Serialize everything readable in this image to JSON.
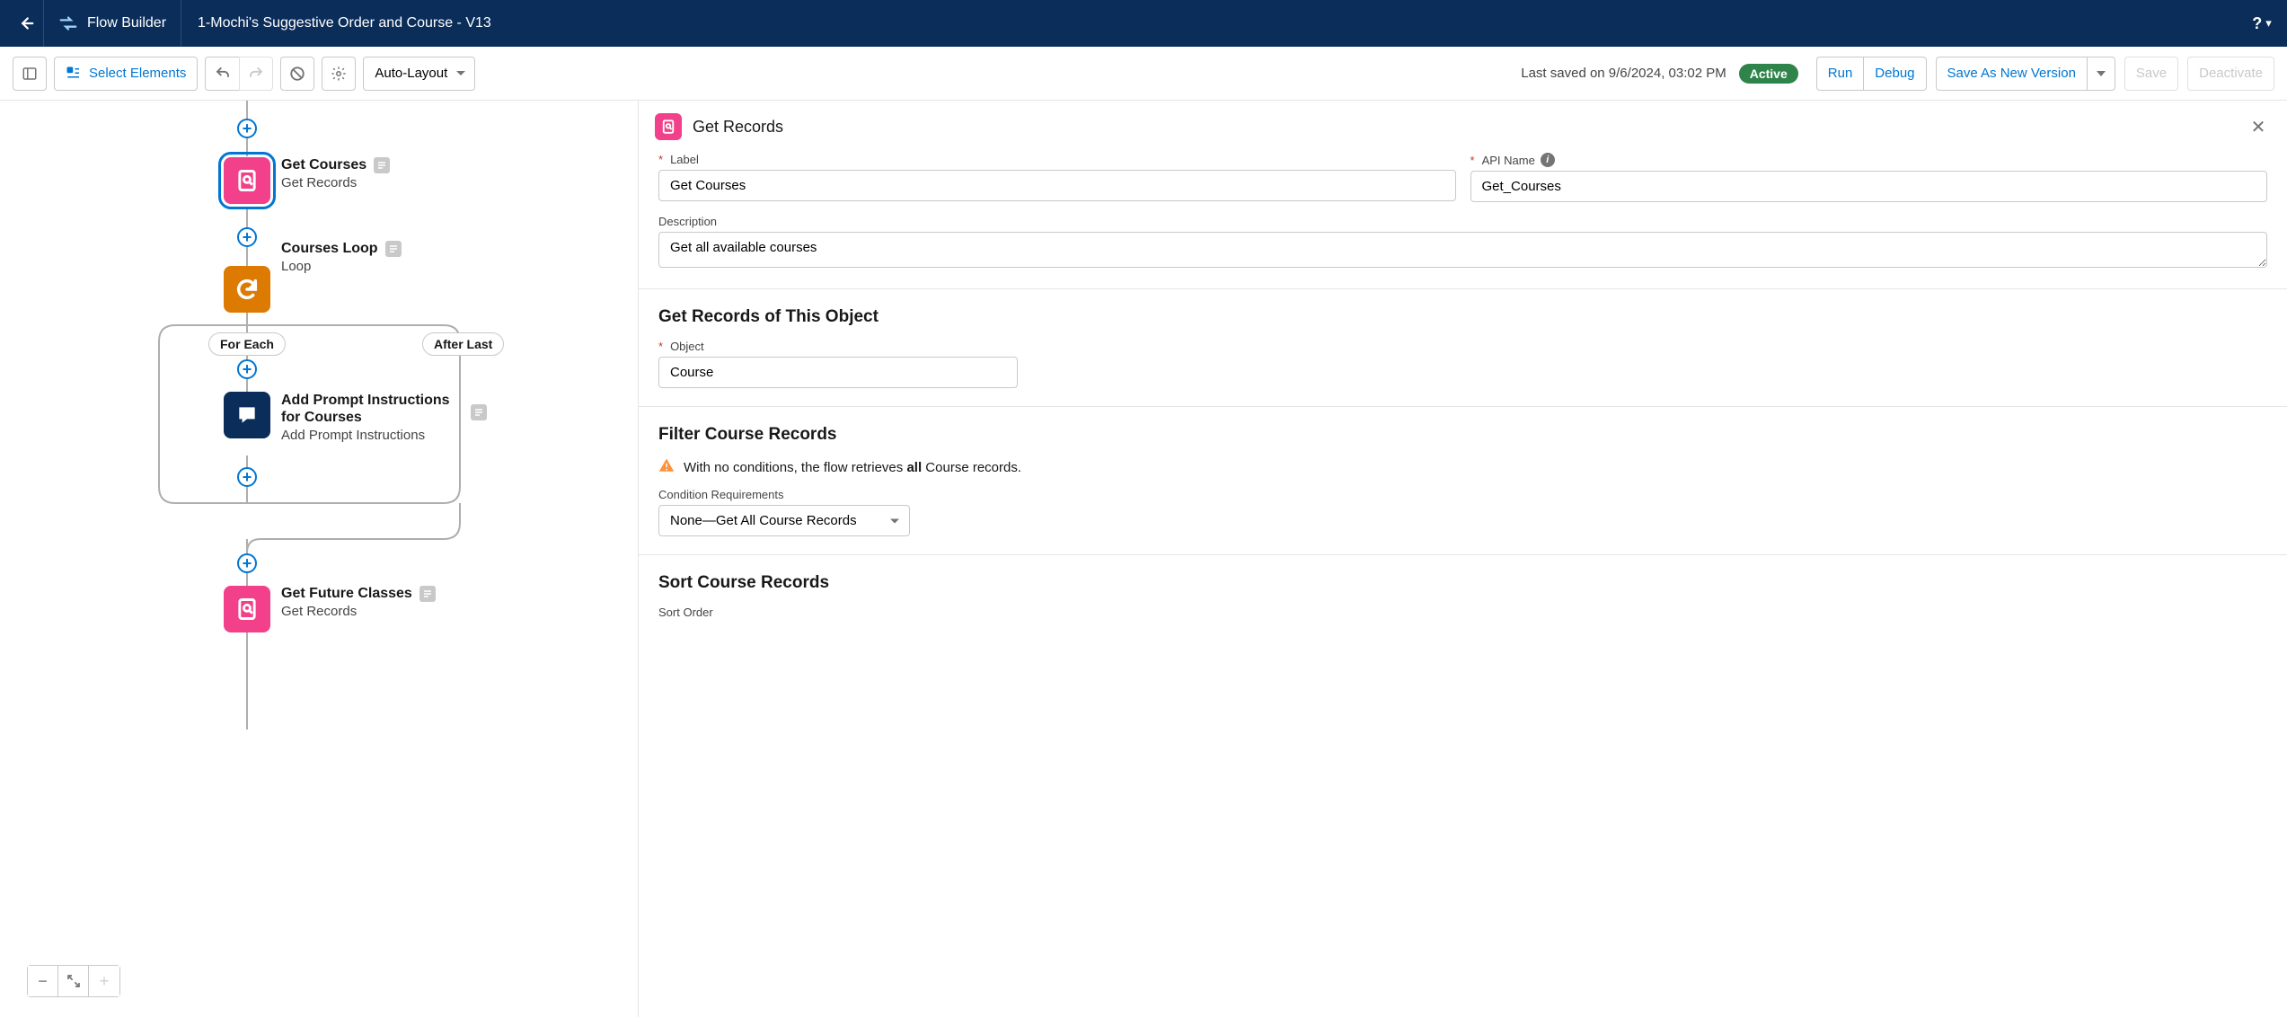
{
  "header": {
    "app_name": "Flow Builder",
    "flow_title": "1-Mochi's Suggestive Order and Course - V13"
  },
  "toolbar": {
    "select_elements": "Select Elements",
    "layout_mode": "Auto-Layout",
    "last_saved_prefix": "Last saved on 9/6/2024, 03:02 PM",
    "status_badge": "Active",
    "run": "Run",
    "debug": "Debug",
    "save_as_new": "Save As New Version",
    "save": "Save",
    "deactivate": "Deactivate"
  },
  "canvas": {
    "nodes": [
      {
        "id": "get_courses",
        "title": "Get Courses",
        "subtitle": "Get Records",
        "has_desc": true
      },
      {
        "id": "courses_loop",
        "title": "Courses Loop",
        "subtitle": "Loop",
        "has_desc": true
      },
      {
        "id": "add_prompt",
        "title": "Add Prompt Instructions for Courses",
        "subtitle": "Add Prompt Instructions",
        "has_desc": true
      },
      {
        "id": "get_future",
        "title": "Get Future Classes",
        "subtitle": "Get Records",
        "has_desc": true
      }
    ],
    "branch_labels": {
      "for_each": "For Each",
      "after_last": "After Last"
    }
  },
  "panel": {
    "header_title": "Get Records",
    "label_field": {
      "label": "Label",
      "value": "Get Courses"
    },
    "api_name_field": {
      "label": "API Name",
      "value": "Get_Courses"
    },
    "description_field": {
      "label": "Description",
      "value": "Get all available courses"
    },
    "section_object_title": "Get Records of This Object",
    "object_field": {
      "label": "Object",
      "value": "Course"
    },
    "section_filter_title": "Filter Course Records",
    "filter_warning_prefix": "With no conditions, the flow retrieves ",
    "filter_warning_bold": "all",
    "filter_warning_suffix": " Course records.",
    "condition_req_label": "Condition Requirements",
    "condition_req_value": "None—Get All Course Records",
    "section_sort_title": "Sort Course Records",
    "sort_order_label": "Sort Order"
  }
}
